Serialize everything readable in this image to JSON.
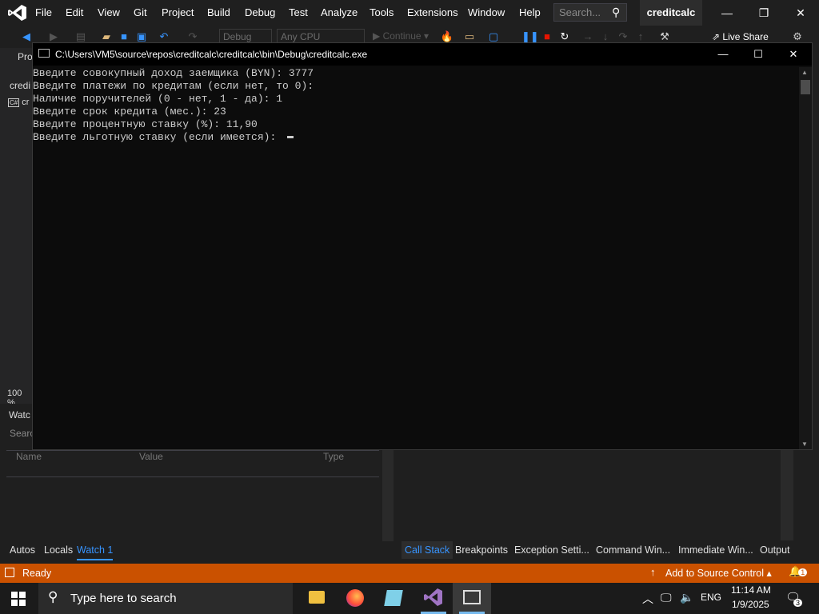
{
  "vs": {
    "menu": [
      "File",
      "Edit",
      "View",
      "Git",
      "Project",
      "Build",
      "Debug",
      "Test",
      "Analyze",
      "Tools",
      "Extensions",
      "Window",
      "Help"
    ],
    "search_placeholder": "Search...",
    "solution_name": "creditcalc",
    "toolbar": {
      "config": "Debug",
      "platform": "Any CPU",
      "continue_label": "Continue",
      "live_share": "Live Share"
    },
    "left_panel": {
      "tab1": "Pro",
      "tab2": "credi",
      "file_tab": "cr",
      "zoom": "100 %"
    },
    "watch": {
      "title": "Watc",
      "search": "Searc",
      "columns": [
        "Name",
        "Value",
        "Type"
      ]
    },
    "bottom_tabs_left": [
      "Autos",
      "Locals",
      "Watch 1"
    ],
    "bottom_tabs_right": [
      "Call Stack",
      "Breakpoints",
      "Exception Setti...",
      "Command Win...",
      "Immediate Win...",
      "Output"
    ],
    "status": "Ready",
    "source_control": "Add to Source Control",
    "notifications": "1"
  },
  "console": {
    "title": "C:\\Users\\VM5\\source\\repos\\creditcalc\\creditcalc\\bin\\Debug\\creditcalc.exe",
    "lines": [
      "Введите совокупный доход заемщика (BYN): 3777",
      "Введите платежи по кредитам (если нет, то 0):",
      "Наличие поручителей (0 - нет, 1 - да): 1",
      "Введите срок кредита (мес.): 23",
      "Введите процентную ставку (%): 11,90",
      "Введите льготную ставку (если имеется): "
    ]
  },
  "taskbar": {
    "search_placeholder": "Type here to search",
    "language": "ENG",
    "time": "11:14 AM",
    "date": "1/9/2025",
    "notification_count": "3"
  },
  "colors": {
    "status_bar": "#ca5100",
    "active_tab": "#3794ff",
    "vs_purple": "#a074c4"
  }
}
